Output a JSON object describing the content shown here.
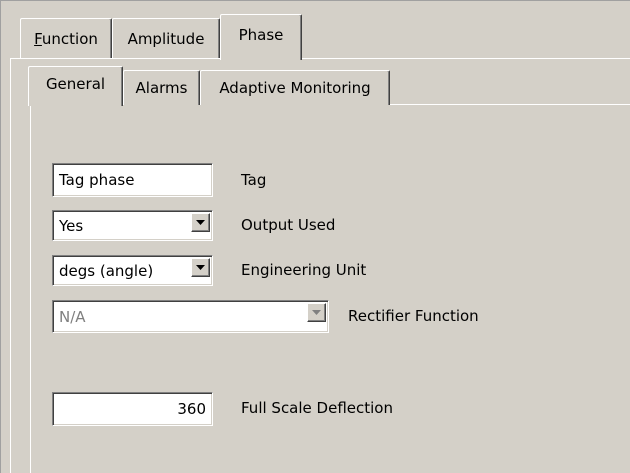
{
  "outer_tabs": [
    {
      "label": "Function",
      "mnemonic": "F",
      "rest": "unction"
    },
    {
      "label": "Amplitude"
    },
    {
      "label": "Phase"
    }
  ],
  "inner_tabs": [
    {
      "label": "General"
    },
    {
      "label": "Alarms"
    },
    {
      "label": "Adaptive Monitoring"
    }
  ],
  "fields": {
    "tag": {
      "value": "Tag phase",
      "label": "Tag"
    },
    "output_used": {
      "value": "Yes",
      "label": "Output Used"
    },
    "engineering_unit": {
      "value": "degs (angle)",
      "label": "Engineering Unit"
    },
    "rectifier_function": {
      "value": "N/A",
      "label": "Rectifier Function"
    },
    "full_scale_deflection": {
      "value": "360",
      "label": "Full Scale Deflection"
    }
  },
  "icons": {
    "dropdown": "chevron-down-icon"
  }
}
